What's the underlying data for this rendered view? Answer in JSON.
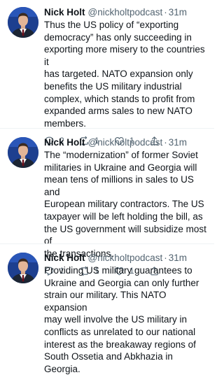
{
  "tweets": [
    {
      "author": {
        "name": "Nick Holt",
        "handle": "@nickholtpodcast",
        "separator": "·",
        "time": "31m"
      },
      "text": "Thus the US policy of “exporting\ndemocracy” has only succeeding in\nexporting more misery to the countries it\nhas targeted. NATO expansion only\nbenefits the US military industrial\ncomplex, which stands to profit from\nexpanded arms sales to new NATO\nmembers.",
      "replies": "2",
      "retweets": "1",
      "likes": "1"
    },
    {
      "author": {
        "name": "Nick Holt",
        "handle": "@nickholtpodcast",
        "separator": "·",
        "time": "31m"
      },
      "text": "The “modernization” of former Soviet\nmilitaries in Ukraine and Georgia will\nmean tens of millions in sales to US and\nEuropean military contractors. The US\ntaxpayer will be left holding the bill, as\nthe US government will subsidize most of\nthe transactions.",
      "replies": "1",
      "retweets": "1",
      "likes": "1"
    },
    {
      "author": {
        "name": "Nick Holt",
        "handle": "@nickholtpodcast",
        "separator": "·",
        "time": "31m"
      },
      "text": "Providing US military guarantees to\nUkraine and Georgia can only further\nstrain our military. This NATO expansion\nmay well involve the US military in\nconflicts as unrelated to our national\ninterest as the breakaway regions of\nSouth Ossetia and Abkhazia in Georgia."
    }
  ],
  "icons": {
    "reply": "reply-icon",
    "retweet": "retweet-icon",
    "like": "heart-icon",
    "share": "share-icon"
  },
  "colors": {
    "text": "#0f1419",
    "secondary": "#536471",
    "divider": "#eff3f4",
    "avatar_bg": "#1d3f8f"
  }
}
